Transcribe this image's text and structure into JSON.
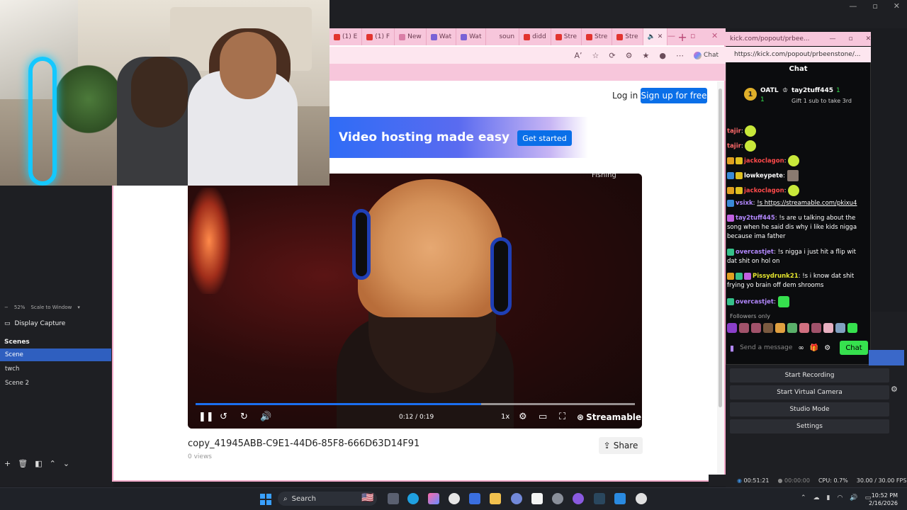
{
  "obs": {
    "zoom": "52%",
    "scale_mode": "Scale to Window",
    "source": "Display Capture",
    "scenes_header": "Scenes",
    "scenes": [
      {
        "label": "Scene",
        "selected": true
      },
      {
        "label": "twch",
        "selected": false
      },
      {
        "label": "Scene 2",
        "selected": false
      }
    ],
    "controls": [
      "Start Recording",
      "Start Virtual Camera",
      "Studio Mode",
      "Settings"
    ],
    "status": {
      "stream_time": "00:51:21",
      "rec_time": "00:00:00",
      "cpu": "CPU: 0.7%",
      "fps": "30.00 / 30.00 FPS"
    }
  },
  "browser": {
    "tabs": [
      "(1) E",
      "(1) F",
      "New",
      "Wat",
      "Wat",
      "soun",
      "didd",
      "Stre",
      "Stre",
      "Stre"
    ],
    "chat_label": "Chat",
    "accent": "#f7c6db"
  },
  "page": {
    "login": "Log in",
    "signup": "Sign up for free",
    "banner_title": "Video hosting made easy",
    "banner_button": "Get started",
    "video_overlay_label": "Fishing",
    "time": "0:12 / 0:19",
    "progress": 0.65,
    "speed": "1x",
    "brand": "Streamable",
    "video_title": "copy_41945ABB-C9E1-44D6-85F8-666D63D14F91",
    "views": "0 views",
    "share": "Share"
  },
  "kick": {
    "url": "kick.com/popout/prbee...",
    "url_full": "https://kick.com/popout/prbeenstone/...",
    "header": "Chat",
    "gift": {
      "rank": "1",
      "user_left": "OATL",
      "count_left": "1",
      "user_right": "tay2tuff445",
      "count_right": "1",
      "gift_text": "Gift 1 sub to take 3rd"
    },
    "messages": [
      {
        "user": "tajir",
        "text": "",
        "color": "#ff6a6a"
      },
      {
        "user": "tajir",
        "text": "",
        "color": "#ff6a6a"
      },
      {
        "user": "jackoclagon",
        "text": "",
        "color": "#ff4a4a"
      },
      {
        "user": "lowkeypete",
        "text": "",
        "color": "#ffffff"
      },
      {
        "user": "jackoclagon",
        "text": "",
        "color": "#ff4a4a"
      },
      {
        "user": "vsixk",
        "text": "!s https://streamable.com/pkixu4",
        "color": "#b388ff"
      },
      {
        "user": "tay2tuff445",
        "text": "!s are u talking about the song when he said dis why i like kids nigga because ima father",
        "color": "#b388ff"
      },
      {
        "user": "overcastjet",
        "text": "!s nigga i just hit a flip wit dat shit on hol on",
        "color": "#b388ff"
      },
      {
        "user": "Pissydrunk21",
        "text": "!s i know dat shit frying yo brain off dem shrooms",
        "color": "#e5e52e"
      },
      {
        "user": "overcastjet",
        "text": "",
        "color": "#b388ff"
      }
    ],
    "followers_only": "Followers only",
    "input_placeholder": "Send a message",
    "send_button": "Chat"
  },
  "taskbar": {
    "search": "Search",
    "time": "10:52 PM",
    "date": "2/16/2026"
  }
}
